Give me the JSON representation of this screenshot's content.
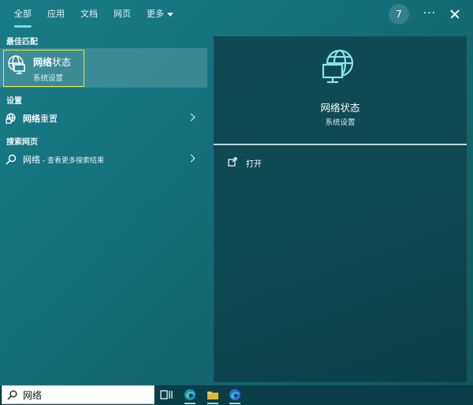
{
  "tabs": {
    "all": "全部",
    "apps": "应用",
    "docs": "文档",
    "web": "网页",
    "more": "更多"
  },
  "header": {
    "badge_count": "7",
    "more_options": "···"
  },
  "best_match": {
    "section_title": "最佳匹配",
    "title_bold": "网络",
    "title_rest": "状态",
    "subtitle": "系统设置",
    "icon": "network-globe-monitor-icon"
  },
  "settings": {
    "section_title": "设置",
    "item_bold": "网络",
    "item_rest": "重置",
    "icon": "network-reset-icon"
  },
  "web_search": {
    "section_title": "搜索网页",
    "item_query": "网络",
    "item_note": " - 查看更多搜索结果",
    "icon": "search-icon"
  },
  "preview": {
    "title": "网络状态",
    "subtitle": "系统设置",
    "action_label": "打开",
    "icon": "network-globe-monitor-icon"
  },
  "taskbar": {
    "search_value": "网络",
    "items": [
      "task-view-icon",
      "edge-icon",
      "file-explorer-icon",
      "edge-dev-icon"
    ]
  },
  "colors": {
    "accent": "#7fd8de",
    "highlight_border": "#e9e63b"
  }
}
